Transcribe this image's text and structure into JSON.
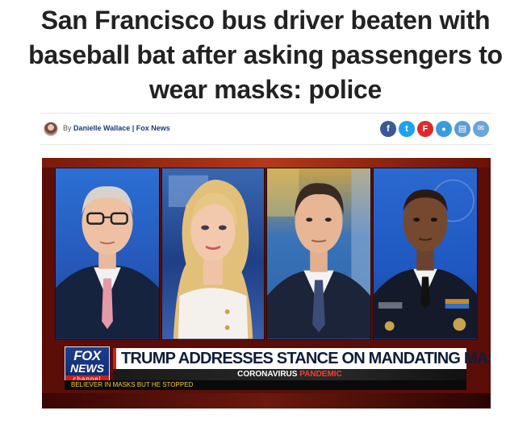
{
  "article": {
    "headline": "San Francisco bus driver beaten with baseball bat after asking passengers to wear masks: police",
    "by_prefix": "By",
    "author": "Danielle Wallace",
    "separator": "|",
    "outlet": "Fox News"
  },
  "share_buttons": [
    {
      "name": "facebook-icon",
      "glyph": "f",
      "color": "#3b5998"
    },
    {
      "name": "twitter-icon",
      "glyph": "t",
      "color": "#1da1f2"
    },
    {
      "name": "flipboard-icon",
      "glyph": "F",
      "color": "#e12828"
    },
    {
      "name": "comments-icon",
      "glyph": "●",
      "color": "#3a9be0"
    },
    {
      "name": "print-icon",
      "glyph": "▤",
      "color": "#5b9bd5"
    },
    {
      "name": "email-icon",
      "glyph": "✉",
      "color": "#6aa5d8"
    }
  ],
  "video": {
    "logo_line1": "FOX",
    "logo_line2": "NEWS",
    "logo_line3": "channel",
    "headline": "TRUMP ADDRESSES STANCE ON MANDATING MASKS",
    "sub_word1": "CORONAVIRUS",
    "sub_word2": "PANDEMIC",
    "ticker": "BELIEVER IN MASKS BUT HE STOPPED"
  }
}
